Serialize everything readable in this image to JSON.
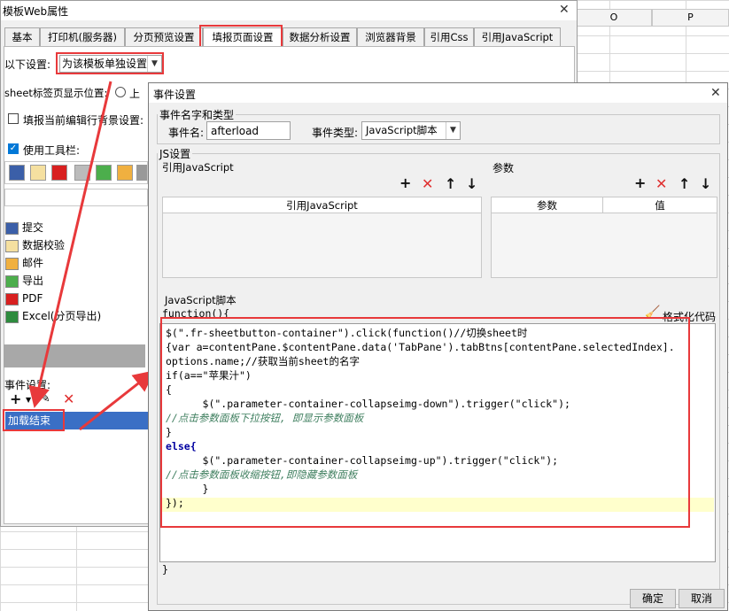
{
  "spreadsheet": {
    "col_o": "O",
    "col_p": "P"
  },
  "win1": {
    "title": "模板Web属性",
    "close": "✕",
    "tabs": [
      "基本",
      "打印机(服务器)",
      "分页预览设置",
      "填报页面设置",
      "数据分析设置",
      "浏览器背景",
      "引用Css",
      "引用JavaScript"
    ],
    "scope_label": "以下设置:",
    "scope_value": "为该模板单独设置",
    "sheet_pos_label": "sheet标签页显示位置:",
    "sheet_pos_radio": "上",
    "bg_label": "填报当前编辑行背景设置:",
    "toolbar_label": "使用工具栏:",
    "items": [
      {
        "label": "提交",
        "icon": "save-icon",
        "color": "#3b5fa8"
      },
      {
        "label": "数据校验",
        "icon": "pencil-icon",
        "color": "#d9a830"
      },
      {
        "label": "邮件",
        "icon": "mail-icon",
        "color": "#f0b040"
      },
      {
        "label": "导出",
        "icon": "export-icon",
        "color": "#555555"
      },
      {
        "label": "PDF",
        "icon": "pdf-icon",
        "color": "#d82020"
      },
      {
        "label": "Excel(分页导出)",
        "icon": "excel-icon",
        "color": "#2e8b3e"
      }
    ],
    "events_label": "事件设置:",
    "event_item": "加载结束"
  },
  "win2": {
    "title": "事件设置",
    "close": "✕",
    "group_name": "事件名字和类型",
    "name_label": "事件名:",
    "name_value": "afterload",
    "type_label": "事件类型:",
    "type_value": "JavaScript脚本",
    "js_group": "JS设置",
    "ref_js_label": "引用JavaScript",
    "params_label": "参数",
    "ref_js_col": "引用JavaScript",
    "param_col": "参数",
    "value_col": "值",
    "script_label": "JavaScript脚本",
    "func_open": "function(){",
    "format_btn": "格式化代码",
    "func_close": "}",
    "ok": "确定",
    "cancel": "取消"
  },
  "code_lines": [
    "$(\".fr-sheetbutton-container\").click(function()//切换sheet时",
    "{var a=contentPane.$contentPane.data('TabPane').tabBtns[contentPane.selectedIndex].",
    "options.name;//获取当前sheet的名字",
    "if(a==\"苹果汁\")",
    "{",
    "      $(\".parameter-container-collapseimg-down\").trigger(\"click\");",
    "//点击参数面板下拉按钮, 即显示参数面板",
    "}",
    "else{",
    "      $(\".parameter-container-collapseimg-up\").trigger(\"click\");",
    "//点击参数面板收缩按钮,即隐藏参数面板",
    "      }",
    "});"
  ],
  "colors": {
    "annotation_red": "#e8393b",
    "selection_blue": "#3a6fc5"
  }
}
